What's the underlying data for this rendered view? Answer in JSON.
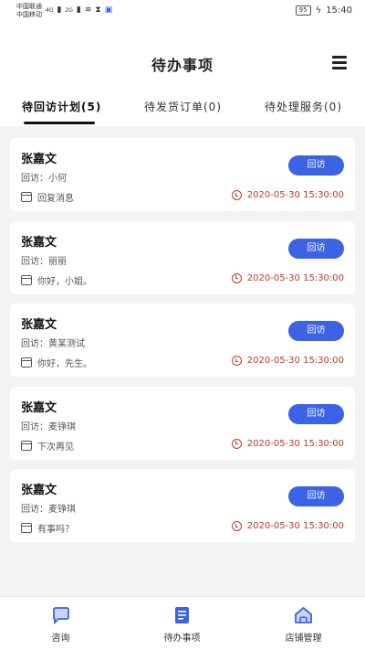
{
  "statusbar": {
    "carrier1": "中国联通",
    "carrier2": "中国移动",
    "net1": "4G",
    "net2": "2G",
    "battery": "95",
    "time": "15:40"
  },
  "nav": {
    "title": "待办事项"
  },
  "tabs": [
    {
      "label": "待回访计划(5)",
      "active": true
    },
    {
      "label": "待发货订单(0)",
      "active": false
    },
    {
      "label": "待处理服务(0)",
      "active": false
    }
  ],
  "cards": [
    {
      "name": "张嘉文",
      "visit": "回访：小何",
      "message": "回复消息",
      "button": "回访",
      "time": "2020-05-30 15:30:00"
    },
    {
      "name": "张嘉文",
      "visit": "回访：丽丽",
      "message": "你好，小姐。",
      "button": "回访",
      "time": "2020-05-30 15:30:00"
    },
    {
      "name": "张嘉文",
      "visit": "回访：黄某测试",
      "message": "你好，先生。",
      "button": "回访",
      "time": "2020-05-30 15:30:00"
    },
    {
      "name": "张嘉文",
      "visit": "回访：麦铮琪",
      "message": "下次再见",
      "button": "回访",
      "time": "2020-05-30 15:30:00"
    },
    {
      "name": "张嘉文",
      "visit": "回访：麦铮琪",
      "message": "有事吗？",
      "button": "回访",
      "time": "2020-05-30 15:30:00"
    }
  ],
  "bottom_nav": [
    {
      "label": "咨询",
      "icon": "chat-bubble-icon"
    },
    {
      "label": "待办事项",
      "icon": "document-list-icon"
    },
    {
      "label": "店铺管理",
      "icon": "store-house-icon"
    }
  ],
  "colors": {
    "accent": "#3a63e6",
    "time_red": "#c0392b"
  }
}
